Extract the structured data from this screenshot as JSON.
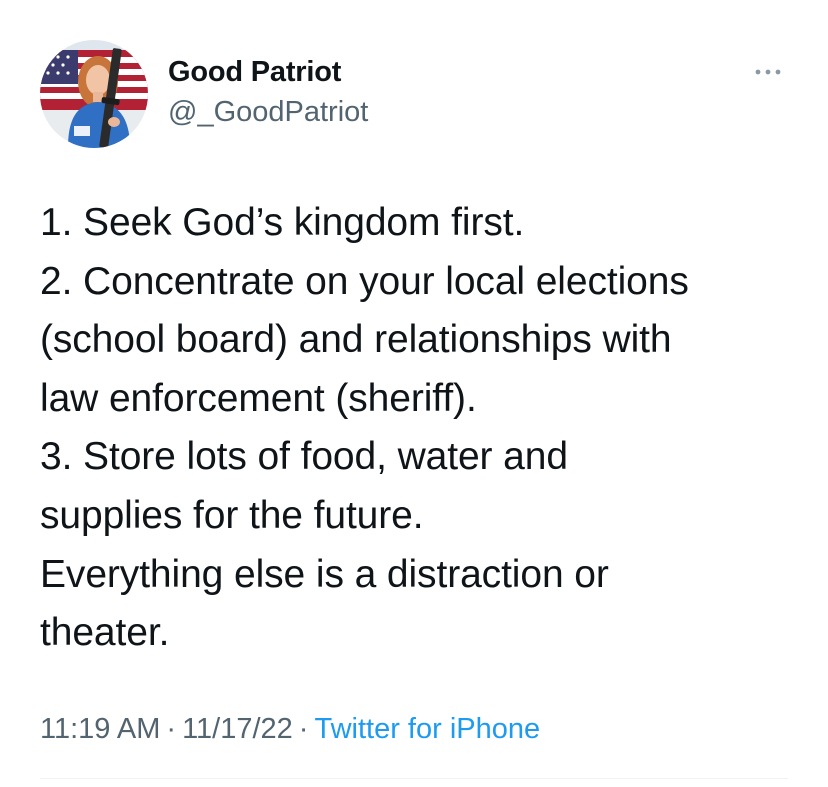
{
  "author": {
    "name": "Good Patriot",
    "handle": "@_GoodPatriot",
    "avatar_icon": "profile-photo"
  },
  "menu": {
    "icon": "more-horizontal-icon"
  },
  "tweet": {
    "lines": [
      "1. Seek God’s kingdom first.",
      "2. Concentrate on your local elections",
      "(school board) and relationships with",
      "law enforcement (sheriff).",
      "3. Store lots of food, water and",
      "supplies for the future.",
      "Everything else is a distraction or",
      "theater."
    ]
  },
  "meta": {
    "time": "11:19 AM",
    "date": "11/17/22",
    "separator": "·",
    "source": "Twitter for iPhone"
  },
  "colors": {
    "text": "#0f1419",
    "secondary": "#536471",
    "link": "#1d9bf0",
    "divider": "#eff3f4"
  }
}
